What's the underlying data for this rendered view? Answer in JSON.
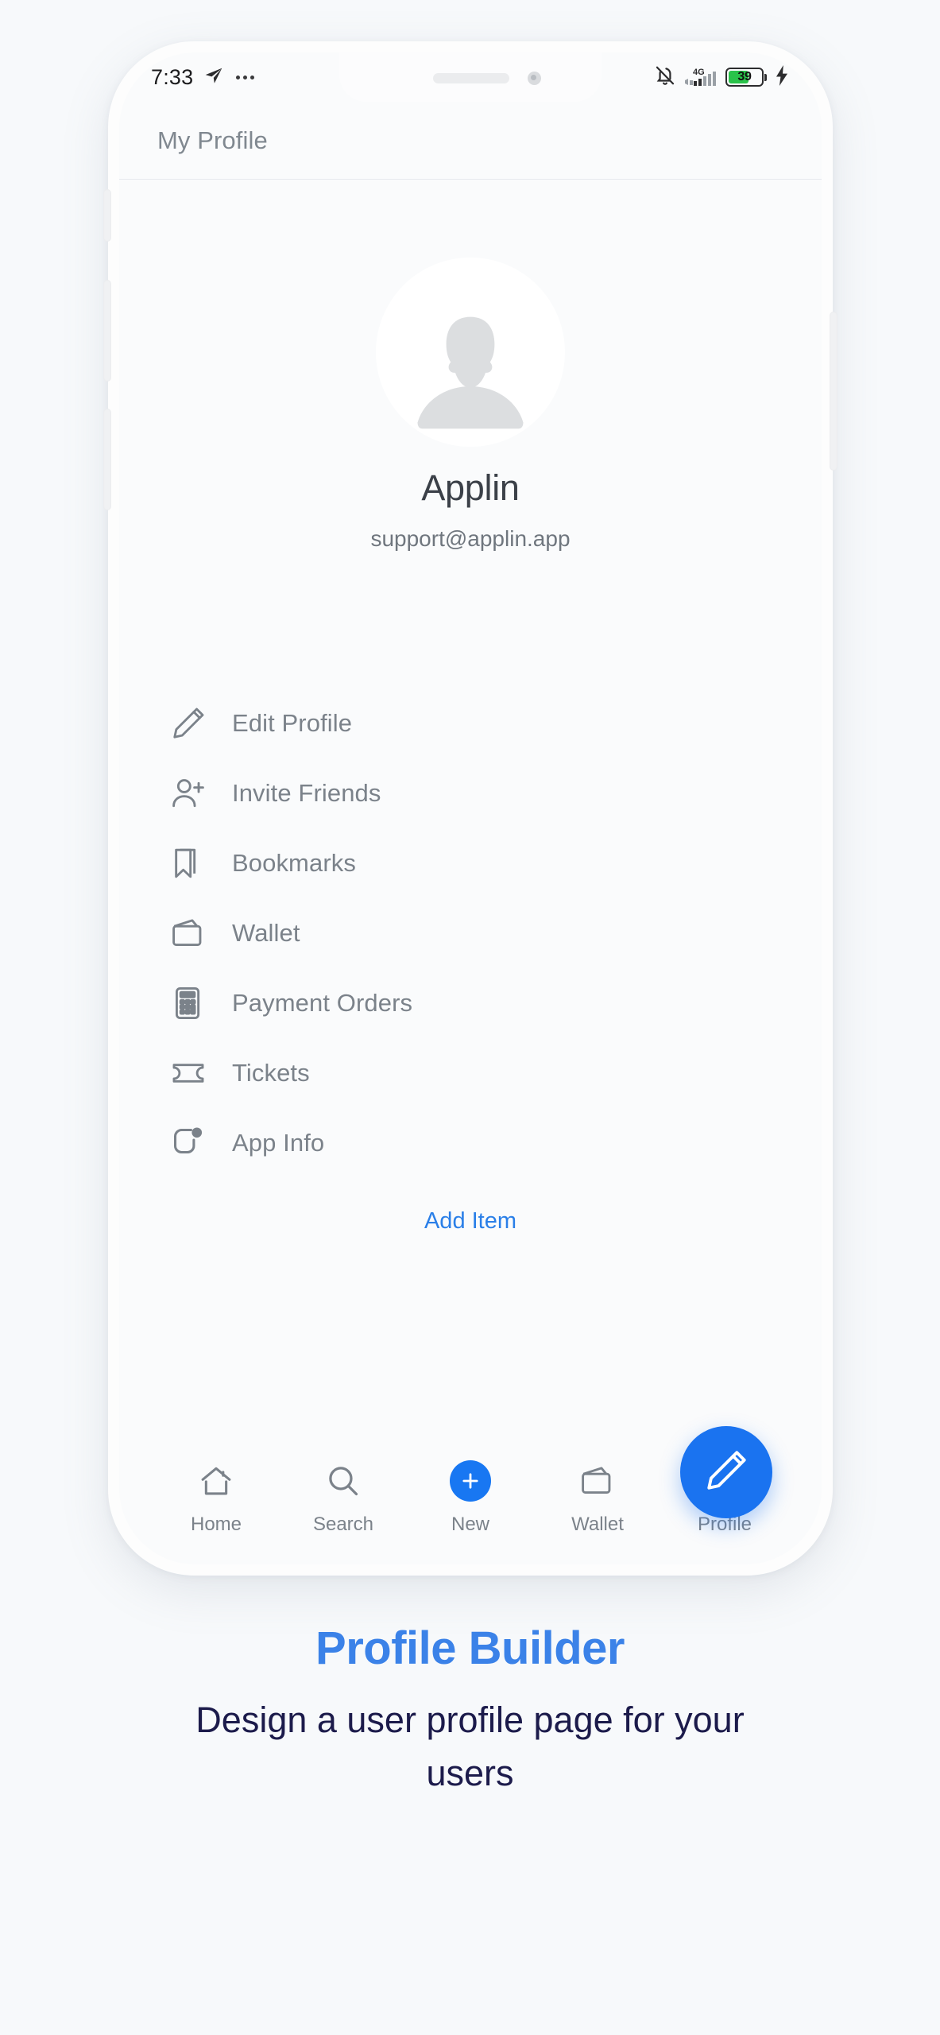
{
  "statusbar": {
    "time": "7:33",
    "send_icon": "telegram-send-icon",
    "overflow_icon": "more-dots-icon",
    "bell_icon": "bell-muted-icon",
    "network_label": "4G",
    "signal_icon": "signal-bars-icon",
    "battery_percent": "39",
    "charging_icon": "charging-bolt-icon"
  },
  "header": {
    "title": "My Profile"
  },
  "profile": {
    "avatar_icon": "avatar-placeholder-icon",
    "name": "Applin",
    "email": "support@applin.app"
  },
  "menu": {
    "items": [
      {
        "label": "Edit Profile",
        "icon": "pencil-icon"
      },
      {
        "label": "Invite Friends",
        "icon": "person-add-icon"
      },
      {
        "label": "Bookmarks",
        "icon": "bookmark-icon"
      },
      {
        "label": "Wallet",
        "icon": "wallet-icon"
      },
      {
        "label": "Payment Orders",
        "icon": "calculator-icon"
      },
      {
        "label": "Tickets",
        "icon": "ticket-icon"
      },
      {
        "label": "App Info",
        "icon": "app-info-icon"
      }
    ],
    "add_item_label": "Add Item"
  },
  "bottomnav": {
    "items": [
      {
        "label": "Home",
        "icon": "home-icon",
        "active": false
      },
      {
        "label": "Search",
        "icon": "search-icon",
        "active": false
      },
      {
        "label": "New",
        "icon": "plus-circle-icon",
        "active": false
      },
      {
        "label": "Wallet",
        "icon": "wallet-icon",
        "active": false
      },
      {
        "label": "Profile",
        "icon": "gauge-icon",
        "active": true
      }
    ],
    "fab_icon": "pencil-edit-icon"
  },
  "caption": {
    "title": "Profile Builder",
    "subtitle": "Design a user profile page for your users"
  },
  "colors": {
    "accent_blue": "#1a73f0",
    "link_blue": "#2a7fe8",
    "caption_title": "#3b82e8",
    "caption_sub": "#1c1b4b",
    "battery_green": "#2ac34a",
    "muted_text": "#7b828a",
    "page_bg": "#f7f9fb"
  }
}
